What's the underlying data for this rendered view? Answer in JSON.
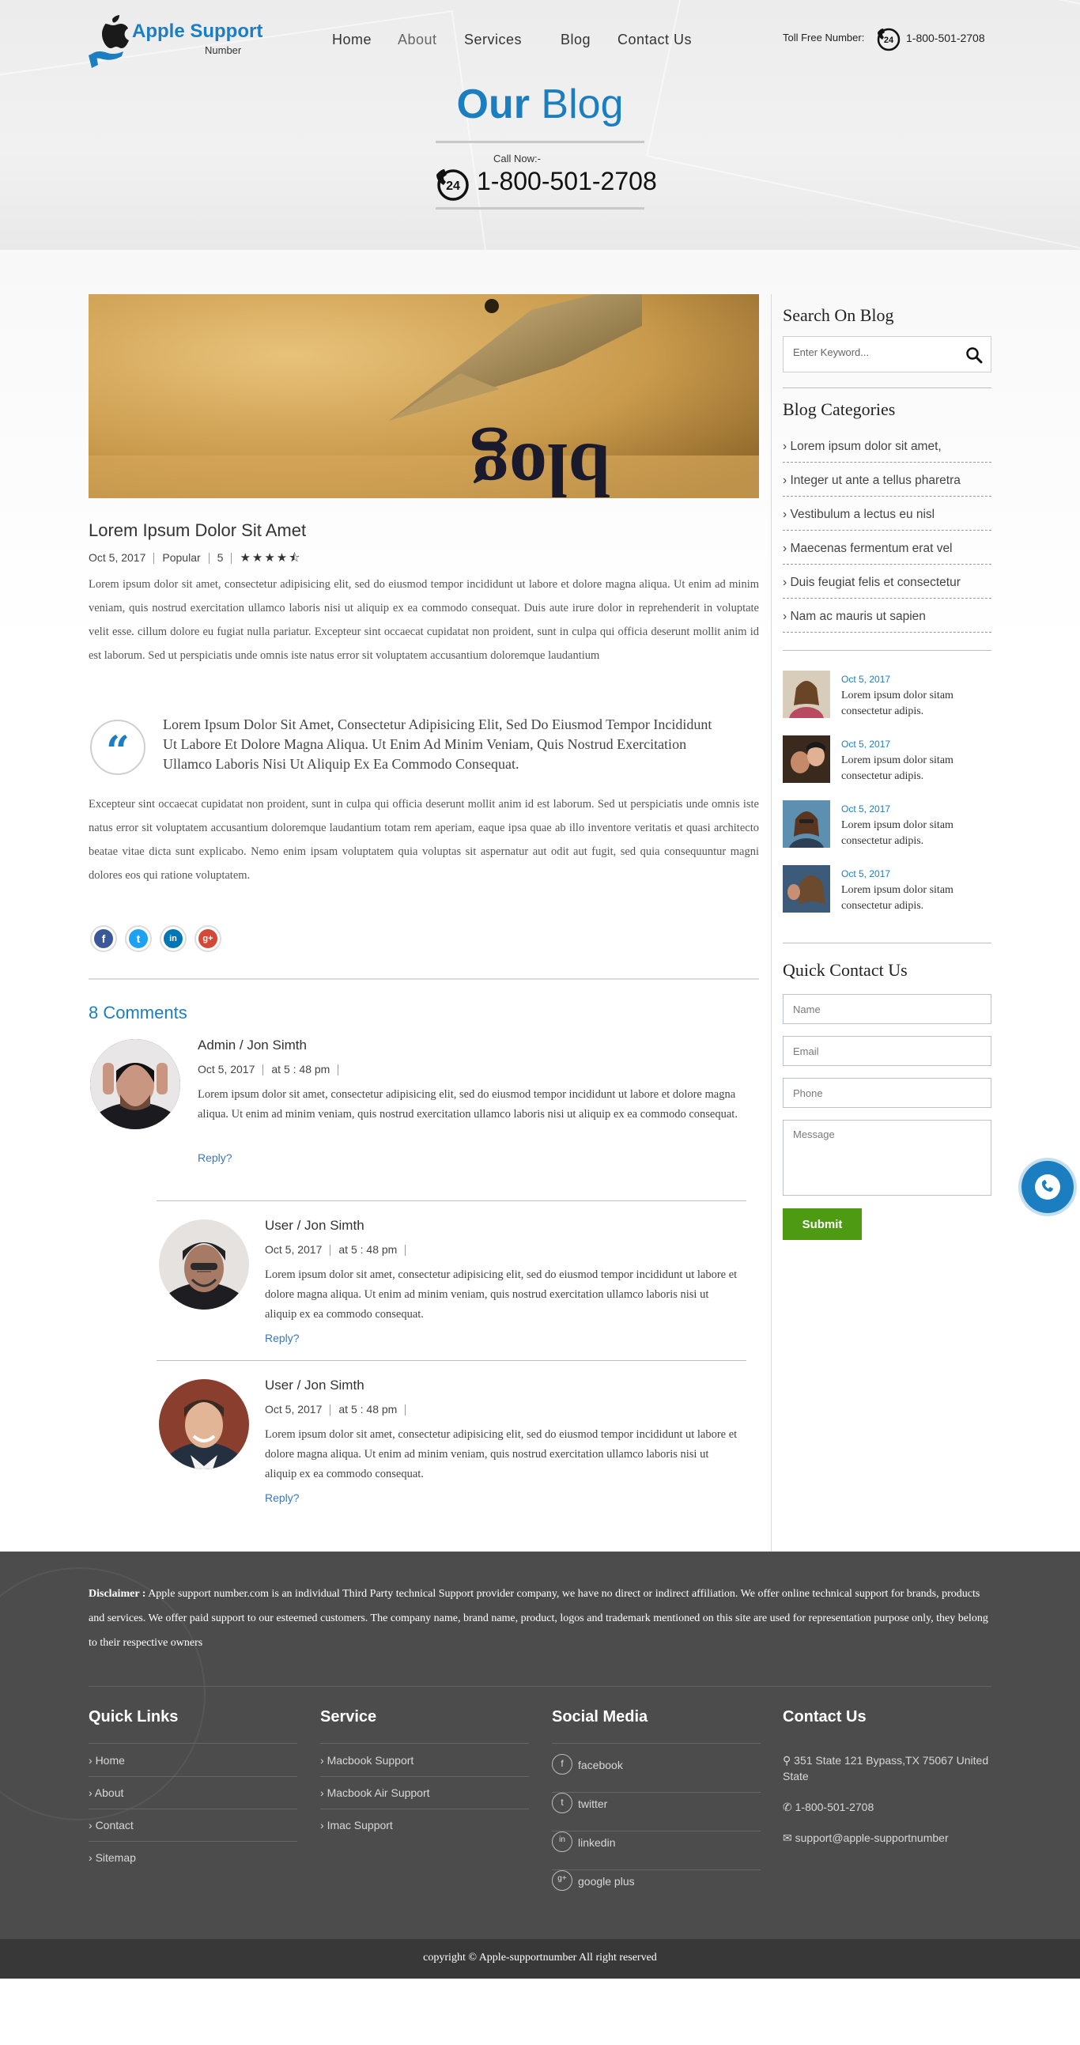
{
  "header": {
    "logo_text": "Apple Support",
    "logo_sub": "Number",
    "nav": [
      "Home",
      "About",
      "Services",
      "Blog",
      "Contact Us"
    ],
    "toll_free_label": "Toll Free Number:",
    "toll_free_number": "1-800-501-2708",
    "page_title_bold": "Our",
    "page_title_rest": "Blog",
    "call_label": "Call Now:-",
    "call_number": "1-800-501-2708",
    "badge_24": "24"
  },
  "post": {
    "title": "Lorem Ipsum Dolor Sit Amet",
    "date": "Oct 5, 2017",
    "category": "Popular",
    "rating_text": "5",
    "rating": 4.5,
    "para1": "Lorem ipsum dolor sit amet, consectetur adipisicing elit, sed do eiusmod tempor incididunt ut labore et dolore magna aliqua. Ut enim ad minim veniam, quis nostrud exercitation ullamco laboris nisi ut aliquip ex ea commodo consequat. Duis aute irure dolor in reprehenderit in voluptate velit esse. cillum dolore eu fugiat nulla pariatur. Excepteur sint occaecat cupidatat non proident, sunt in culpa qui officia deserunt mollit anim id est laborum. Sed ut perspiciatis unde omnis iste natus error sit voluptatem accusantium doloremque laudantium",
    "quote": "Lorem Ipsum Dolor Sit Amet, Consectetur Adipisicing Elit, Sed Do Eiusmod Tempor Incididunt Ut Labore Et Dolore Magna Aliqua. Ut Enim Ad Minim Veniam, Quis Nostrud Exercitation Ullamco Laboris Nisi Ut Aliquip Ex Ea Commodo Consequat.",
    "para2": "Excepteur sint occaecat cupidatat non proident, sunt in culpa qui officia deserunt mollit anim id est laborum. Sed ut perspiciatis unde omnis iste natus error sit voluptatem accusantium doloremque laudantium totam rem aperiam, eaque ipsa quae ab illo inventore veritatis et quasi architecto beatae vitae dicta sunt explicabo. Nemo enim ipsam voluptatem quia voluptas sit aspernatur aut odit aut fugit, sed quia consequuntur magni dolores eos qui ratione voluptatem.",
    "image_text": "blog",
    "share": [
      {
        "name": "facebook",
        "glyph": "f",
        "color": "#3b5998"
      },
      {
        "name": "twitter",
        "glyph": "t",
        "color": "#1da1f2"
      },
      {
        "name": "linkedin",
        "glyph": "in",
        "color": "#0077b5"
      },
      {
        "name": "google-plus",
        "glyph": "g+",
        "color": "#d34836"
      }
    ]
  },
  "comments": {
    "title": "8 Comments",
    "items": [
      {
        "name": "Admin / Jon Simth",
        "date": "Oct 5, 2017",
        "time": "at 5 : 48 pm",
        "text": "Lorem ipsum dolor sit amet, consectetur adipisicing elit, sed do eiusmod tempor incididunt ut labore et dolore magna aliqua. Ut enim ad minim veniam, quis nostrud exercitation ullamco laboris nisi ut aliquip ex ea commodo consequat.",
        "reply": "Reply?"
      },
      {
        "name": "User / Jon Simth",
        "date": "Oct 5, 2017",
        "time": "at 5 : 48 pm",
        "text": "Lorem ipsum dolor sit amet, consectetur adipisicing elit, sed do eiusmod tempor incididunt ut labore et dolore magna aliqua. Ut enim ad minim veniam, quis nostrud exercitation ullamco laboris nisi ut aliquip ex ea commodo consequat.",
        "reply": "Reply?"
      },
      {
        "name": "User / Jon Simth",
        "date": "Oct 5, 2017",
        "time": "at 5 : 48 pm",
        "text": "Lorem ipsum dolor sit amet, consectetur adipisicing elit, sed do eiusmod tempor incididunt ut labore et dolore magna aliqua. Ut enim ad minim veniam, quis nostrud exercitation ullamco laboris nisi ut aliquip ex ea commodo consequat.",
        "reply": "Reply?"
      }
    ]
  },
  "sidebar": {
    "search_title": "Search On Blog",
    "search_placeholder": "Enter Keyword...",
    "categories_title": "Blog Categories",
    "categories": [
      "Lorem ipsum dolor sit amet,",
      "Integer ut ante a tellus pharetra",
      "Vestibulum a lectus eu nisl",
      "Maecenas fermentum erat vel",
      "Duis feugiat felis et consectetur",
      "Nam ac mauris ut sapien"
    ],
    "recent": [
      {
        "date": "Oct 5, 2017",
        "text": "Lorem ipsum dolor sitam consectetur adipis."
      },
      {
        "date": "Oct 5, 2017",
        "text": "Lorem ipsum dolor sitam consectetur adipis."
      },
      {
        "date": "Oct 5, 2017",
        "text": "Lorem ipsum dolor sitam consectetur adipis."
      },
      {
        "date": "Oct 5, 2017",
        "text": "Lorem ipsum dolor sitam consectetur adipis."
      }
    ],
    "contact_title": "Quick Contact Us",
    "name_placeholder": "Name",
    "email_placeholder": "Email",
    "phone_placeholder": "Phone",
    "message_placeholder": "Message",
    "submit_label": "Submit"
  },
  "footer": {
    "disclaimer_label": "Disclaimer :",
    "disclaimer_text": "Apple support number.com is an individual Third Party technical Support provider company, we have no direct or indirect affiliation. We offer online technical support for brands, products and services. We offer paid support to our esteemed customers. The company name, brand name, product, logos and trademark mentioned on this site are used for representation purpose only, they belong to their respective owners",
    "quick_links_title": "Quick Links",
    "quick_links": [
      "Home",
      "About",
      "Contact",
      "Sitemap"
    ],
    "service_title": "Service",
    "services": [
      "Macbook Support",
      "Macbook Air Support",
      "Imac Support"
    ],
    "social_title": "Social Media",
    "social": [
      {
        "label": "facebook",
        "glyph": "f"
      },
      {
        "label": "twitter",
        "glyph": "t"
      },
      {
        "label": "linkedin",
        "glyph": "in"
      },
      {
        "label": "google plus",
        "glyph": "g+"
      }
    ],
    "contact_title": "Contact Us",
    "address": "351 State 121 Bypass,TX 75067 United State",
    "phone": "1-800-501-2708",
    "email": "support@apple-supportnumber",
    "copyright": "copyright © Apple-supportnumber All right reserved"
  },
  "colors": {
    "accent": "#1b7ec0",
    "submit": "#4f9a13",
    "footer": "#4c4c4c",
    "copybar": "#383838"
  }
}
